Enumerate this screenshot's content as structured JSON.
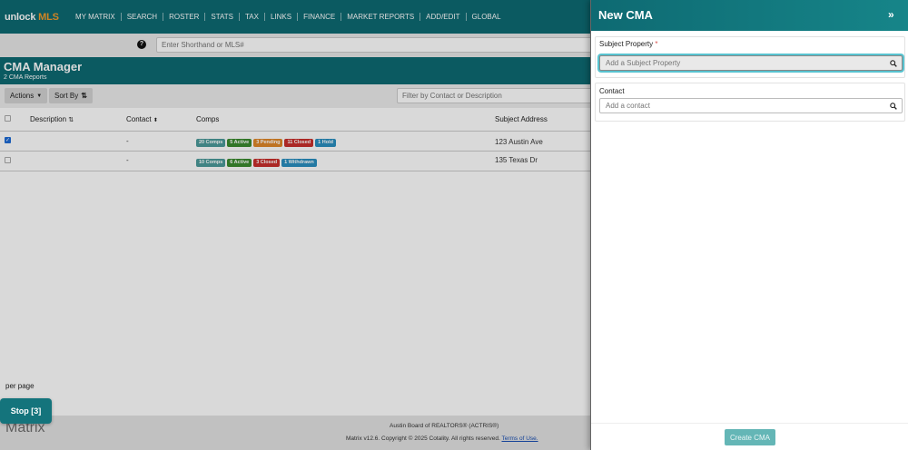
{
  "nav": {
    "logo_part1": "unlock",
    "logo_part2": "MLS",
    "links": [
      "MY MATRIX",
      "SEARCH",
      "ROSTER",
      "STATS",
      "TAX",
      "LINKS",
      "FINANCE",
      "MARKET REPORTS",
      "ADD/EDIT",
      "GLOBAL"
    ]
  },
  "search": {
    "placeholder": "Enter Shorthand or MLS#",
    "help_icon": "?"
  },
  "manager": {
    "title": "CMA Manager",
    "subtitle": "2 CMA Reports"
  },
  "toolbar": {
    "actions_label": "Actions",
    "sort_label": "Sort By",
    "filter_placeholder": "Filter by Contact or Description"
  },
  "table": {
    "headers": {
      "description": "Description",
      "contact": "Contact",
      "comps": "Comps",
      "subject_address": "Subject Address"
    },
    "rows": [
      {
        "checked": true,
        "contact": "-",
        "badges": [
          {
            "label": "20 Comps",
            "color": "#4c9a9a"
          },
          {
            "label": "5 Active",
            "color": "#3b8b2f"
          },
          {
            "label": "3 Pending",
            "color": "#e0882a"
          },
          {
            "label": "11 Closed",
            "color": "#c9302c"
          },
          {
            "label": "1 Hold",
            "color": "#2a8fc0"
          }
        ],
        "address": "123 Austin Ave"
      },
      {
        "checked": false,
        "contact": "-",
        "badges": [
          {
            "label": "10 Comps",
            "color": "#4c9a9a"
          },
          {
            "label": "6 Active",
            "color": "#3b8b2f"
          },
          {
            "label": "3 Closed",
            "color": "#c9302c"
          },
          {
            "label": "1 Withdrawn",
            "color": "#2a8fc0"
          }
        ],
        "address": "135 Texas Dr"
      }
    ]
  },
  "pagination": {
    "per_page_label": "per page"
  },
  "footer": {
    "logo": "Matrix",
    "line1": "Austin Board of REALTORS® (ACTRIS®)",
    "line2": "Matrix v12.6. Copyright © 2025 Cotality. All rights reserved.",
    "terms_link": "Terms of Use."
  },
  "stop_button": "Stop [3]",
  "panel": {
    "title": "New CMA",
    "collapse_icon": "»",
    "subject_label": "Subject Property",
    "required_mark": "*",
    "subject_placeholder": "Add a Subject Property",
    "contact_label": "Contact",
    "contact_placeholder": "Add a contact",
    "create_button": "Create CMA"
  },
  "colors": {
    "brand_teal": "#0e6a72",
    "logo_orange": "#f39c2b",
    "focus_ring": "#58c3d0",
    "create_button": "#64b6b6"
  }
}
